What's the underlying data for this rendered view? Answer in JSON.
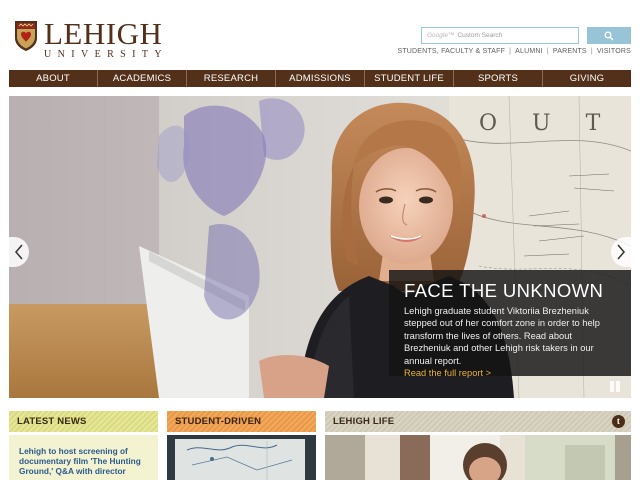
{
  "logo": {
    "wordmark": "LEHIGH",
    "subtitle": "UNIVERSITY",
    "icon": "crest-icon"
  },
  "search": {
    "brand": "Google™",
    "placeholder": "Custom Search",
    "button_icon": "search-icon"
  },
  "quicklinks": [
    "STUDENTS, FACULTY & STAFF",
    "ALUMNI",
    "PARENTS",
    "VISITORS"
  ],
  "nav": [
    "ABOUT",
    "ACADEMICS",
    "RESEARCH",
    "ADMISSIONS",
    "STUDENT LIFE",
    "SPORTS",
    "GIVING"
  ],
  "hero": {
    "map_letters": "O U T H",
    "caption_title": "FACE THE UNKNOWN",
    "caption_body": "Lehigh graduate student Viktoriia Brezheniuk stepped out of her comfort zone in order to help transform the lives of others. Read about Brezheniuk and other Lehigh risk takers in our annual report.",
    "caption_link": "Read the full report >",
    "prev_icon": "chevron-left-icon",
    "next_icon": "chevron-right-icon",
    "pause_icon": "pause-icon"
  },
  "panels": {
    "news": {
      "title": "LATEST NEWS",
      "headline": "Lehigh to host screening of documentary film 'The Hunting Ground,' Q&A with director"
    },
    "research": {
      "title": "STUDENT-DRIVEN RESEARCH"
    },
    "life": {
      "title": "LEHIGH LIFE",
      "icon": "tumblr-icon",
      "icon_glyph": "t"
    }
  },
  "colors": {
    "brand_brown": "#53301a",
    "search_blue": "#98c4d8",
    "news_yellow": "#e6e79a",
    "research_orange": "#f4a95a",
    "life_beige": "#dad4c4",
    "link_gold": "#e8b43a"
  }
}
